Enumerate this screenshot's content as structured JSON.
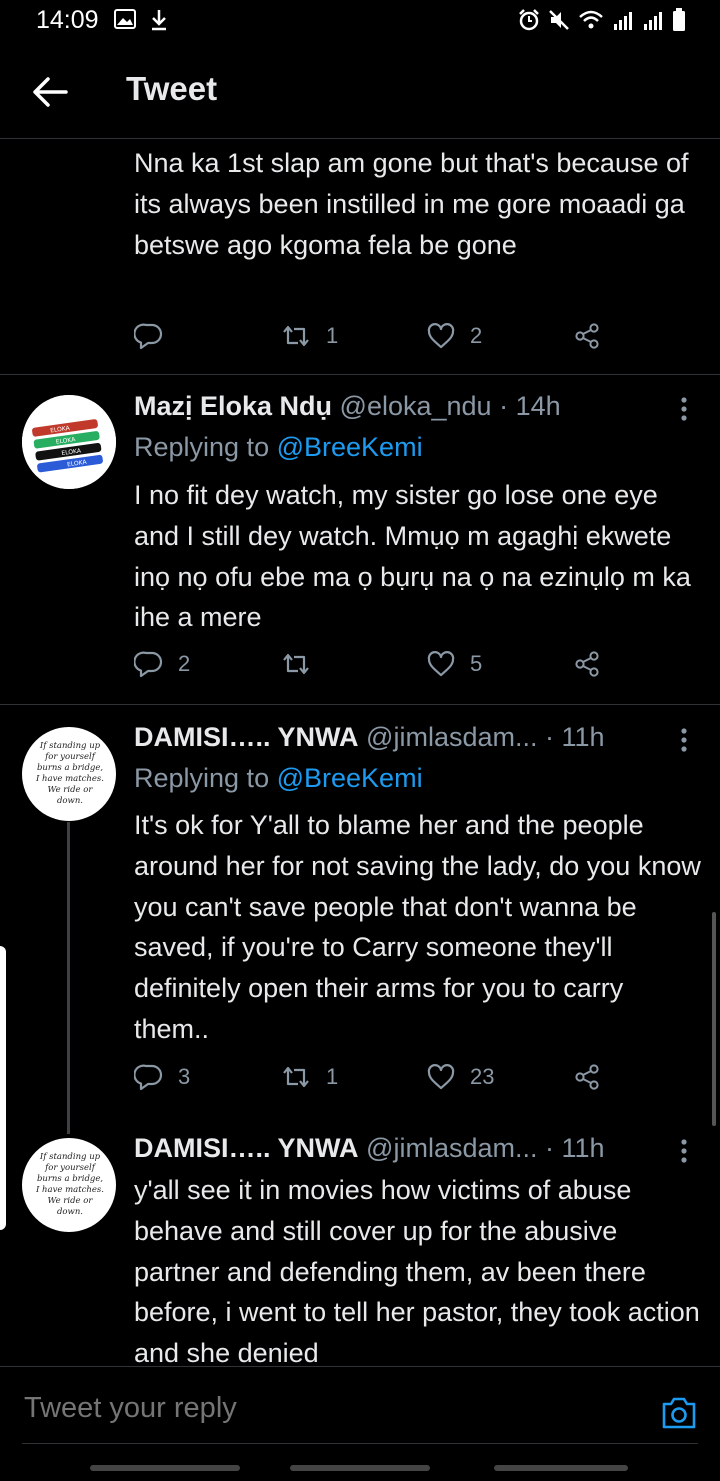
{
  "status_bar": {
    "time": "14:09"
  },
  "header": {
    "title": "Tweet"
  },
  "tweets": [
    {
      "text": "Nna ka 1st slap am gone but that's because of its always been instilled in me gore moaadi ga betswe ago kgoma fela be gone",
      "replies": "",
      "retweets": "1",
      "likes": "2"
    },
    {
      "name": "Mazị Eloka Ndụ",
      "handle": "@eloka_ndu",
      "time": "· 14h",
      "replying_prefix": "Replying to",
      "replying_to": "@BreeKemi",
      "text": "I no fit dey watch, my sister go lose one eye and I still dey watch. Mmụọ m agaghị ekwete inọ nọ ofu ebe ma ọ bụrụ na ọ na ezinụlọ m ka ihe a mere",
      "replies": "2",
      "retweets": "",
      "likes": "5",
      "avatar_labels": [
        "ELOKA",
        "ELOKA",
        "ELOKA",
        "ELOKA"
      ]
    },
    {
      "name": "DAMISI….. YNWA",
      "handle": "@jimlasdam...",
      "time": "· 11h",
      "replying_prefix": "Replying to",
      "replying_to": "@BreeKemi",
      "text": "It's ok for Y'all to blame her and the people around her for not saving the lady, do you know you can't save people that don't wanna be saved, if you're to Carry someone they'll definitely open their arms for you to carry them..",
      "replies": "3",
      "retweets": "1",
      "likes": "23",
      "avatar_text": "If standing up for yourself burns a bridge, I have matches. We ride or down."
    },
    {
      "name": "DAMISI….. YNWA",
      "handle": "@jimlasdam...",
      "time": "· 11h",
      "text": "y'all see it in movies how victims of abuse behave and still cover up for the abusive partner and defending them, av been there before,  i went to tell her pastor, they took action and she denied",
      "avatar_text": "If standing up for yourself burns a bridge, I have matches. We ride or down."
    }
  ],
  "reply_box": {
    "placeholder": "Tweet your reply"
  },
  "colors": {
    "background": "#000000",
    "accent": "#1d9bf0",
    "muted": "#8b98a5",
    "text": "#e7e9ea",
    "divider": "#2f3336"
  },
  "icons": [
    "back-arrow-icon",
    "reply-icon",
    "retweet-icon",
    "like-icon",
    "share-icon",
    "more-icon",
    "camera-icon",
    "gallery-icon",
    "download-icon",
    "alarm-icon",
    "mute-icon",
    "wifi-icon",
    "signal-icon",
    "battery-icon"
  ]
}
